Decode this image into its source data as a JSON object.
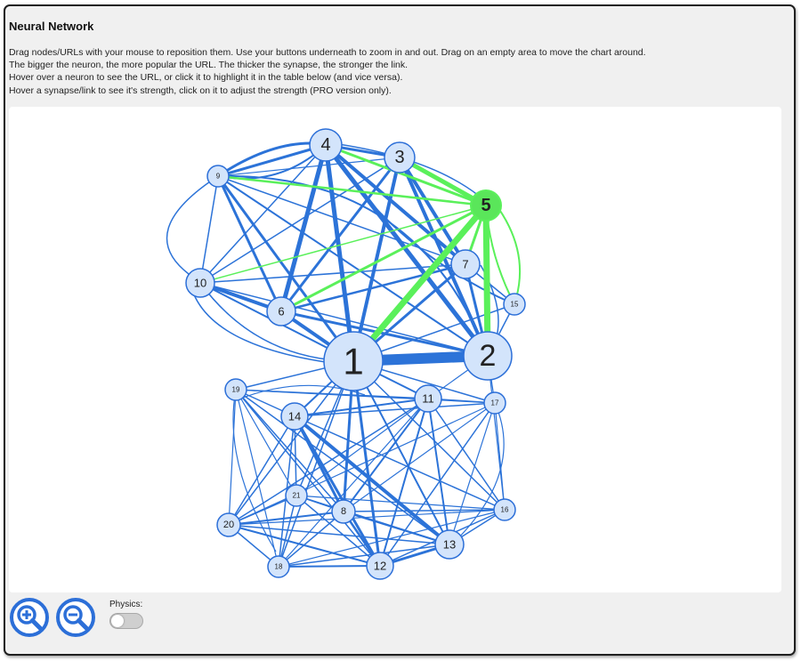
{
  "panel": {
    "title": "Neural Network",
    "description": [
      "Drag nodes/URLs with your mouse to reposition them. Use your buttons underneath to zoom in and out. Drag on an empty area to move the chart around.",
      "The bigger the neuron, the more popular the URL. The thicker the synapse, the stronger the link.",
      "Hover over a neuron to see the URL, or click it to highlight it in the table below (and vice versa).",
      "Hover a synapse/link to see it's strength, click on it to adjust the strength (PRO version only)."
    ]
  },
  "controls": {
    "zoom_in_icon": "zoom-in-icon",
    "zoom_out_icon": "zoom-out-icon",
    "physics_label": "Physics:",
    "physics_enabled": false
  },
  "colors": {
    "edge": "#2c73d8",
    "edge_highlight": "#5af05a",
    "node_fill": "#d3e4fb",
    "node_stroke": "#2c6fd8",
    "node_highlight_fill": "#5ae65a"
  },
  "network": {
    "selected_node": "5",
    "nodes": [
      {
        "id": "1",
        "label": "1"
      },
      {
        "id": "2",
        "label": "2"
      },
      {
        "id": "3",
        "label": "3"
      },
      {
        "id": "4",
        "label": "4"
      },
      {
        "id": "5",
        "label": "5"
      },
      {
        "id": "6",
        "label": "6"
      },
      {
        "id": "7",
        "label": "7"
      },
      {
        "id": "8",
        "label": "8"
      },
      {
        "id": "9",
        "label": "9"
      },
      {
        "id": "10",
        "label": "10"
      },
      {
        "id": "11",
        "label": "11"
      },
      {
        "id": "12",
        "label": "12"
      },
      {
        "id": "13",
        "label": "13"
      },
      {
        "id": "14",
        "label": "14"
      },
      {
        "id": "15",
        "label": "15"
      },
      {
        "id": "16",
        "label": "16"
      },
      {
        "id": "17",
        "label": "17"
      },
      {
        "id": "18",
        "label": "18"
      },
      {
        "id": "19",
        "label": "19"
      },
      {
        "id": "20",
        "label": "20"
      },
      {
        "id": "21",
        "label": "21"
      }
    ]
  }
}
